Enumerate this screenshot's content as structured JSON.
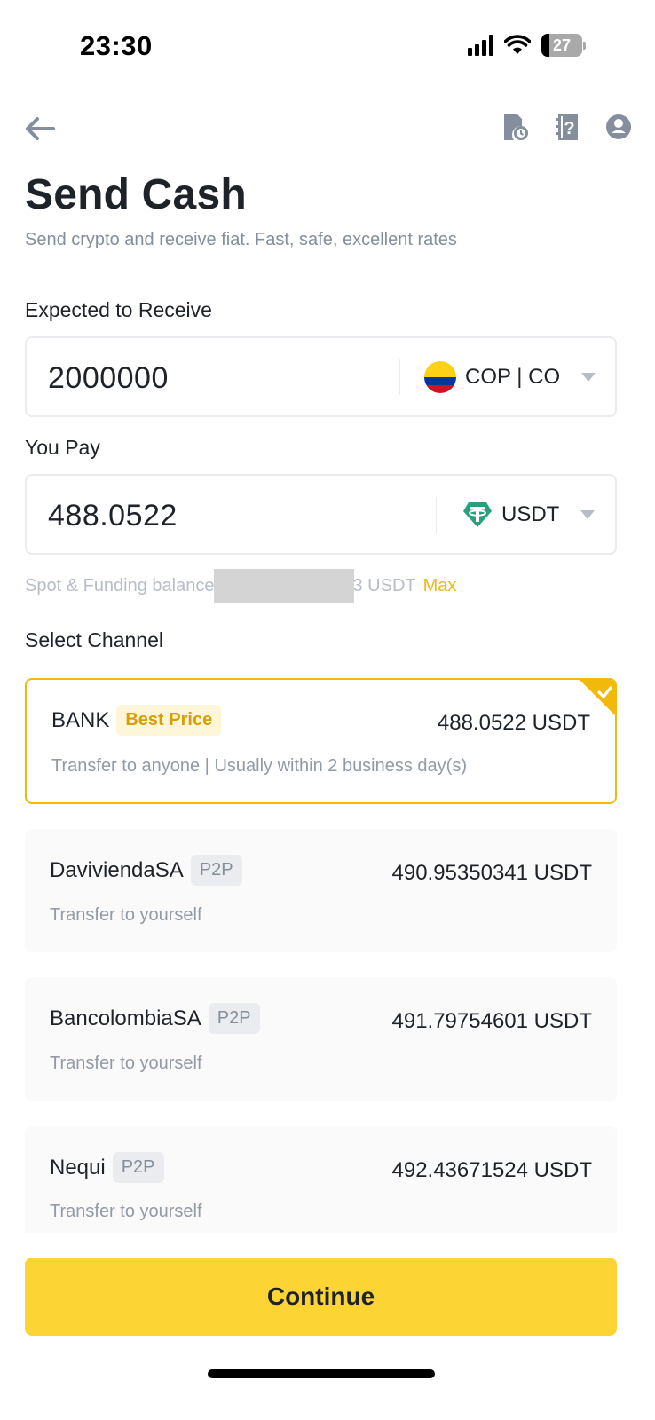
{
  "status_bar": {
    "time": "23:30",
    "battery_level": "27",
    "icons": [
      "signal-icon",
      "wifi-icon",
      "battery-icon"
    ]
  },
  "nav": {
    "icons": [
      "back-arrow-icon",
      "order-history-icon",
      "help-guide-icon",
      "account-icon"
    ]
  },
  "header": {
    "title": "Send Cash",
    "subtitle": "Send crypto and receive fiat. Fast, safe, excellent rates"
  },
  "receive": {
    "label": "Expected to Receive",
    "value": "2000000",
    "currency": "COP | CO",
    "currency_icon": "colombia-flag-icon"
  },
  "pay": {
    "label": "You Pay",
    "value": "488.0522",
    "currency": "USDT",
    "currency_icon": "tether-icon"
  },
  "balance": {
    "prefix": "Spot & Funding balance",
    "suffix": "3 USDT",
    "max_label": "Max"
  },
  "channels": {
    "label": "Select Channel",
    "items": [
      {
        "name": "BANK",
        "tag": "Best Price",
        "amount": "488.0522 USDT",
        "description": "Transfer to anyone | Usually within 2 business day(s)",
        "selected": true
      },
      {
        "name": "DaviviendaSA",
        "tag": "P2P",
        "amount": "490.95350341 USDT",
        "description": "Transfer to yourself",
        "selected": false
      },
      {
        "name": "BancolombiaSA",
        "tag": "P2P",
        "amount": "491.79754601 USDT",
        "description": "Transfer to yourself",
        "selected": false
      },
      {
        "name": "Nequi",
        "tag": "P2P",
        "amount": "492.43671524 USDT",
        "description": "Transfer to yourself",
        "selected": false
      }
    ]
  },
  "footer": {
    "continue_label": "Continue"
  },
  "colors": {
    "accent": "#fcd535",
    "accent_text": "#f0b90b",
    "text_primary": "#1e2329",
    "text_secondary": "#848e9c"
  }
}
